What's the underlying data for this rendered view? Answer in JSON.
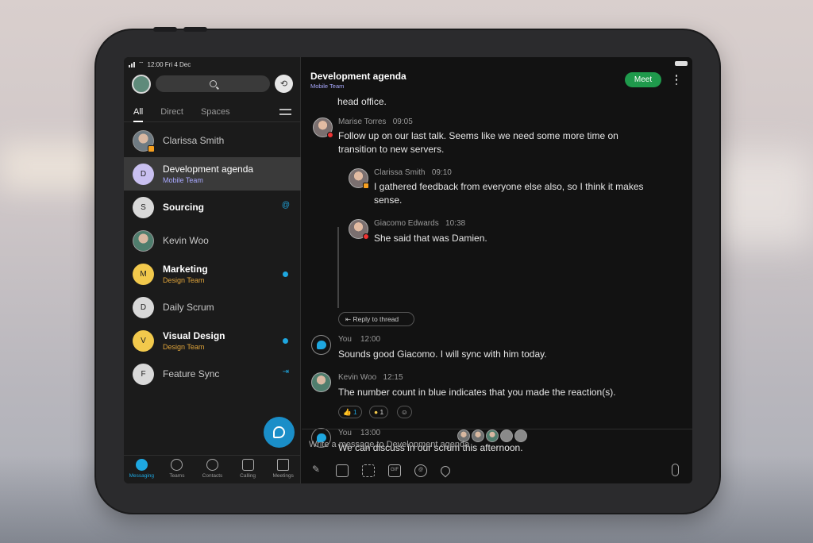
{
  "status_bar": {
    "time_date": "12:00  Fri 4 Dec"
  },
  "left_panel": {
    "filters": [
      "All",
      "Direct",
      "Spaces"
    ],
    "conversations": [
      {
        "name": "Clarissa Smith",
        "initial": "",
        "sub": "",
        "bold": false
      },
      {
        "name": "Development agenda",
        "initial": "D",
        "sub": "Mobile Team",
        "bold": false
      },
      {
        "name": "Sourcing",
        "initial": "S",
        "sub": "",
        "bold": true
      },
      {
        "name": "Kevin Woo",
        "initial": "",
        "sub": "",
        "bold": false
      },
      {
        "name": "Marketing",
        "initial": "M",
        "sub": "Design Team",
        "bold": true
      },
      {
        "name": "Daily Scrum",
        "initial": "D",
        "sub": "",
        "bold": false
      },
      {
        "name": "Visual Design",
        "initial": "V",
        "sub": "Design Team",
        "bold": true
      },
      {
        "name": "Feature Sync",
        "initial": "F",
        "sub": "",
        "bold": false
      }
    ],
    "badges": {
      "sourcing": "@"
    },
    "nav": [
      "Messaging",
      "Teams",
      "Contacts",
      "Calling",
      "Meetings"
    ]
  },
  "chat": {
    "title": "Development agenda",
    "subtitle": "Mobile Team",
    "meet_label": "Meet",
    "messages": [
      {
        "body": "head office."
      },
      {
        "author": "Marise Torres",
        "time": "09:05",
        "body_1": "Follow up on our last talk. Seems like we need some more time on",
        "body_2": "transition to new servers."
      },
      {
        "author": "Clarissa Smith",
        "time": "09:10",
        "body_1": "I gathered feedback from everyone else also, so I think it makes",
        "body_2": "sense."
      },
      {
        "author": "Giacomo Edwards",
        "time": "10:38",
        "body": "She said that was Damien."
      },
      {
        "author": "You",
        "time": "12:00",
        "body": "Sounds good Giacomo. I will sync with him today."
      },
      {
        "author": "Kevin Woo",
        "time": "12:15",
        "body": "The number count in blue indicates that you made the reaction(s)."
      },
      {
        "author": "You",
        "time": "13:00",
        "body": "We can discuss in our scrum this afternoon."
      }
    ],
    "reply_label": "Reply to thread",
    "reactions": [
      {
        "emoji": "👍",
        "count": "1"
      },
      {
        "emoji": "●",
        "count": "1"
      }
    ],
    "composer_placeholder": "Write a message to Development agenda"
  },
  "colors": {
    "accent": "#1ea7e0",
    "meet": "#1f9a4c",
    "team": "#a9a9ff",
    "design": "#e0a43a"
  }
}
